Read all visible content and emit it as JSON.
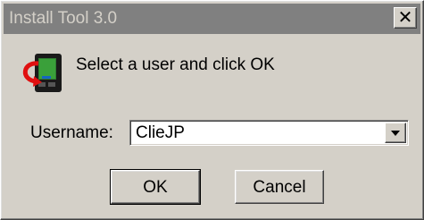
{
  "window": {
    "title": "Install Tool 3.0",
    "close_glyph": "✕",
    "close_icon": "close-icon"
  },
  "header": {
    "icon": "palm-device-sync-icon",
    "prompt": "Select a user and click OK"
  },
  "form": {
    "username_label": "Username:",
    "username_value": "ClieJP",
    "dropdown_icon": "chevron-down-icon"
  },
  "buttons": {
    "ok_label": "OK",
    "cancel_label": "Cancel"
  },
  "colors": {
    "dialog_bg": "#d4d0c8",
    "titlebar_inactive": "#808080",
    "field_bg": "#ffffff"
  }
}
